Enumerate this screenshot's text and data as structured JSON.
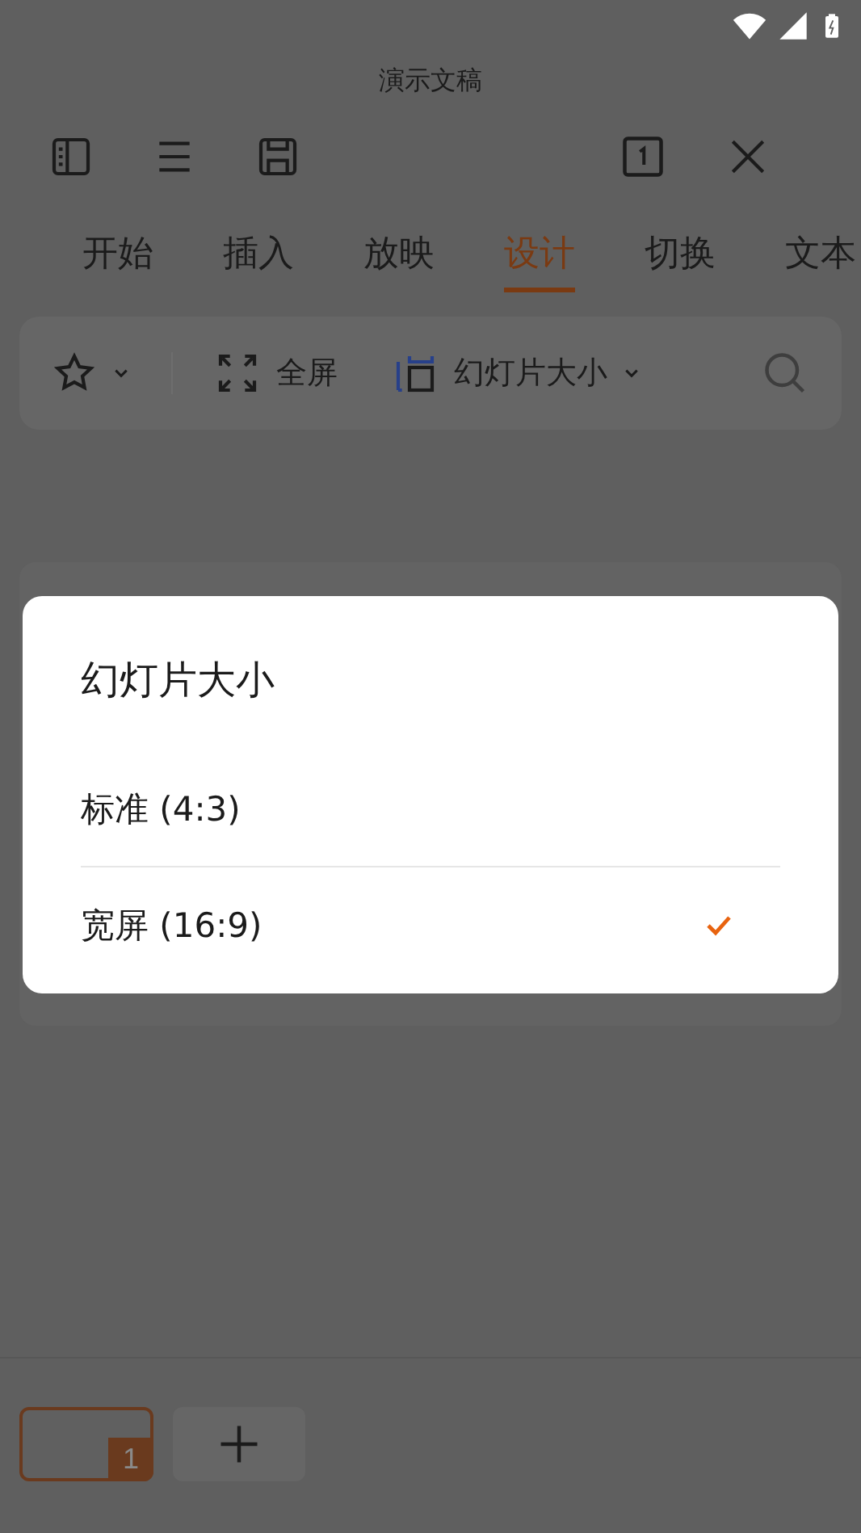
{
  "window": {
    "title": "演示文稿"
  },
  "tabs": [
    {
      "label": "开始",
      "selected": false
    },
    {
      "label": "插入",
      "selected": false
    },
    {
      "label": "放映",
      "selected": false
    },
    {
      "label": "设计",
      "selected": true
    },
    {
      "label": "切换",
      "selected": false
    },
    {
      "label": "文本",
      "selected": false
    }
  ],
  "ribbon": [
    {
      "kind": "favorite"
    },
    {
      "kind": "fullscreen",
      "label": "全屏"
    },
    {
      "kind": "slide_size",
      "label": "幻灯片大小"
    },
    {
      "kind": "search"
    }
  ],
  "dialog": {
    "title": "幻灯片大小",
    "options": [
      {
        "label": "标准 (4:3)",
        "selected": false
      },
      {
        "label": "宽屏 (16:9)",
        "selected": true
      }
    ]
  },
  "slides": [
    {
      "number": "1",
      "selected": true
    }
  ]
}
